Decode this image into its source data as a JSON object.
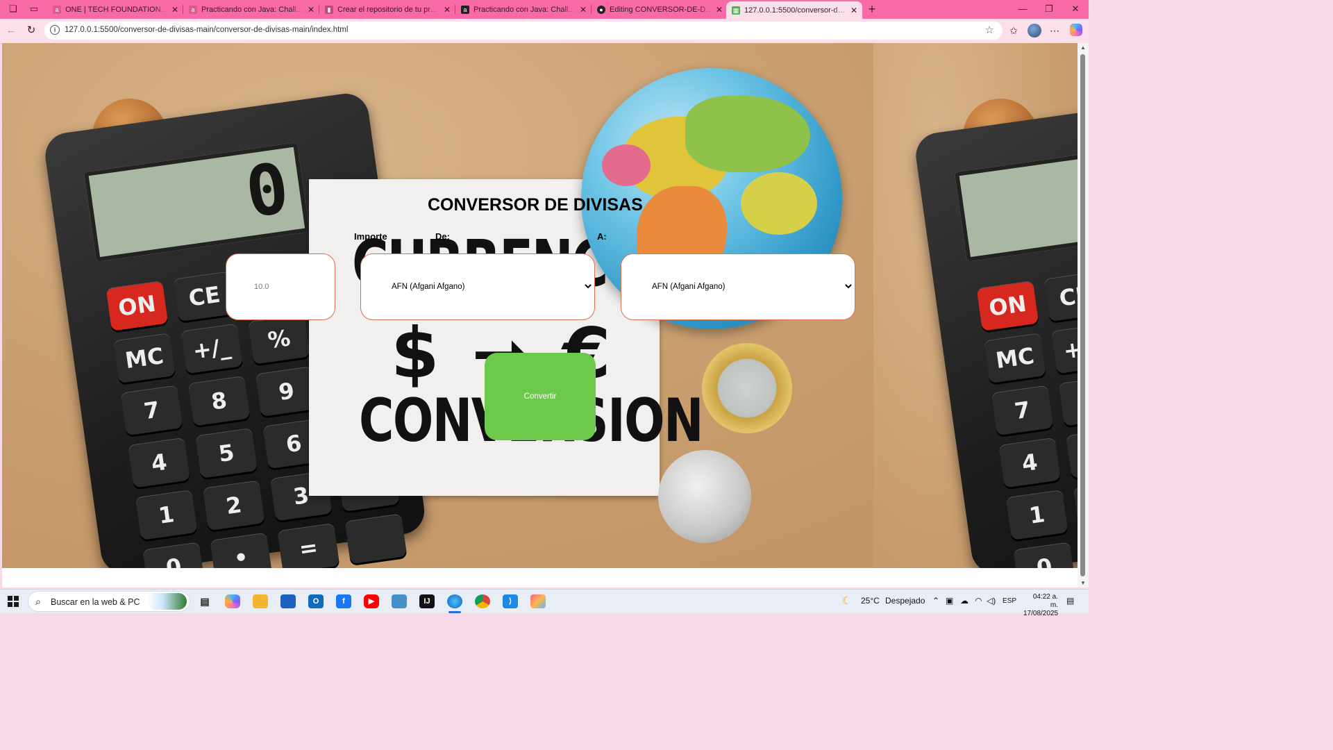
{
  "browser": {
    "tabs": [
      {
        "title": "ONE | TECH FOUNDATION - Espe",
        "favicon": "alura-icon",
        "active": false
      },
      {
        "title": "Practicando con Java: Challenge C",
        "favicon": "alura-icon",
        "active": false
      },
      {
        "title": "Crear el repositorio de tu proyect",
        "favicon": "trello-icon",
        "active": false
      },
      {
        "title": "Practicando con Java: Challenge C",
        "favicon": "alura-icon",
        "active": false
      },
      {
        "title": "Editing CONVERSOR-DE-DIVISAS",
        "favicon": "github-icon",
        "active": false
      },
      {
        "title": "127.0.0.1:5500/conversor-de-divis",
        "favicon": "page-icon",
        "active": true
      }
    ],
    "url": "127.0.0.1:5500/conversor-de-divisas-main/conversor-de-divisas-main/index.html"
  },
  "app": {
    "title": "CONVERSOR DE DIVISAS",
    "labels": {
      "amount": "Importe",
      "from": "De:",
      "to": "A:"
    },
    "amount_placeholder": "10.0",
    "from_currency": "AFN (Afgani Afgano)",
    "to_currency": "AFN (Afgani Afgano)",
    "convert_label": "Convertir",
    "colors": {
      "convert_button": "#6cc94b",
      "field_border": "#d9704e"
    }
  },
  "background_photo": {
    "card_line1": "CURRENCY",
    "card_symbols": "$ ➞ €",
    "card_line2": "CONVERSION",
    "calculator_display": "0",
    "calculator_keys": [
      "ON",
      "CE",
      "C",
      "",
      "MC",
      "+/_",
      "%",
      "÷",
      "7",
      "8",
      "9",
      "×",
      "4",
      "5",
      "6",
      "−",
      "1",
      "2",
      "3",
      "+",
      "0",
      "•",
      "=",
      ""
    ]
  },
  "taskbar": {
    "search_placeholder": "Buscar en la web & PC",
    "weather_temp": "25°C",
    "weather_text": "Despejado",
    "language": "ESP",
    "time": "04:22 a. m.",
    "date": "17/08/2025"
  }
}
